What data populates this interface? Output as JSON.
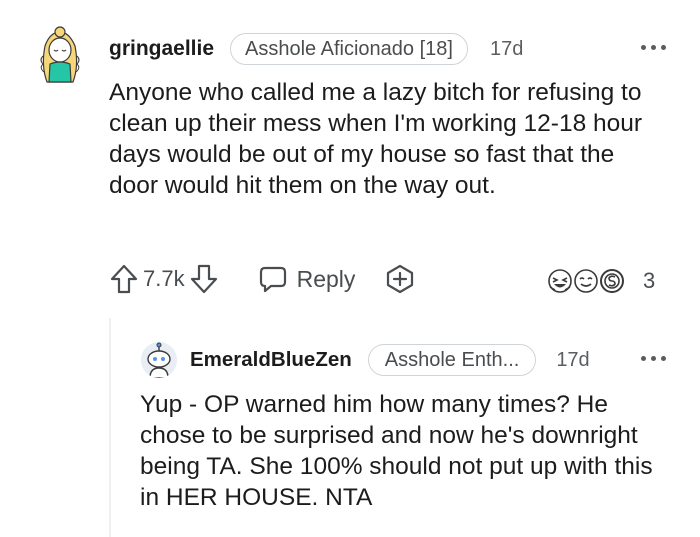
{
  "colors": {
    "text": "#1c1c1c",
    "secondary": "#4a4d50",
    "flair_border": "#cfd4d9",
    "avatar_teal": "#24c6a6",
    "avatar_blonde": "#f5d77a",
    "avatar_blue": "#5396e6"
  },
  "comment": {
    "username": "gringaellie",
    "flair": "Asshole Aficionado [18]",
    "age": "17d",
    "body": "Anyone who called me a lazy bitch for refusing to clean up their mess when I'm working 12-18 hour days would be out of my house so fast that the door would hit them on the way out.",
    "score": "7.7k",
    "reply_label": "Reply",
    "awards_count": "3",
    "icons": {
      "more": "more-options-icon",
      "upvote": "upvote-arrow-icon",
      "downvote": "downvote-arrow-icon",
      "reply": "speech-bubble-icon",
      "award": "add-award-icon",
      "awards": "award-icons"
    }
  },
  "reply": {
    "username": "EmeraldBlueZen",
    "flair": "Asshole Enth...",
    "age": "17d",
    "body": "Yup - OP warned him how many times? He chose to be surprised and now he's downright being TA. She 100% should not put up with this in HER HOUSE. NTA"
  }
}
